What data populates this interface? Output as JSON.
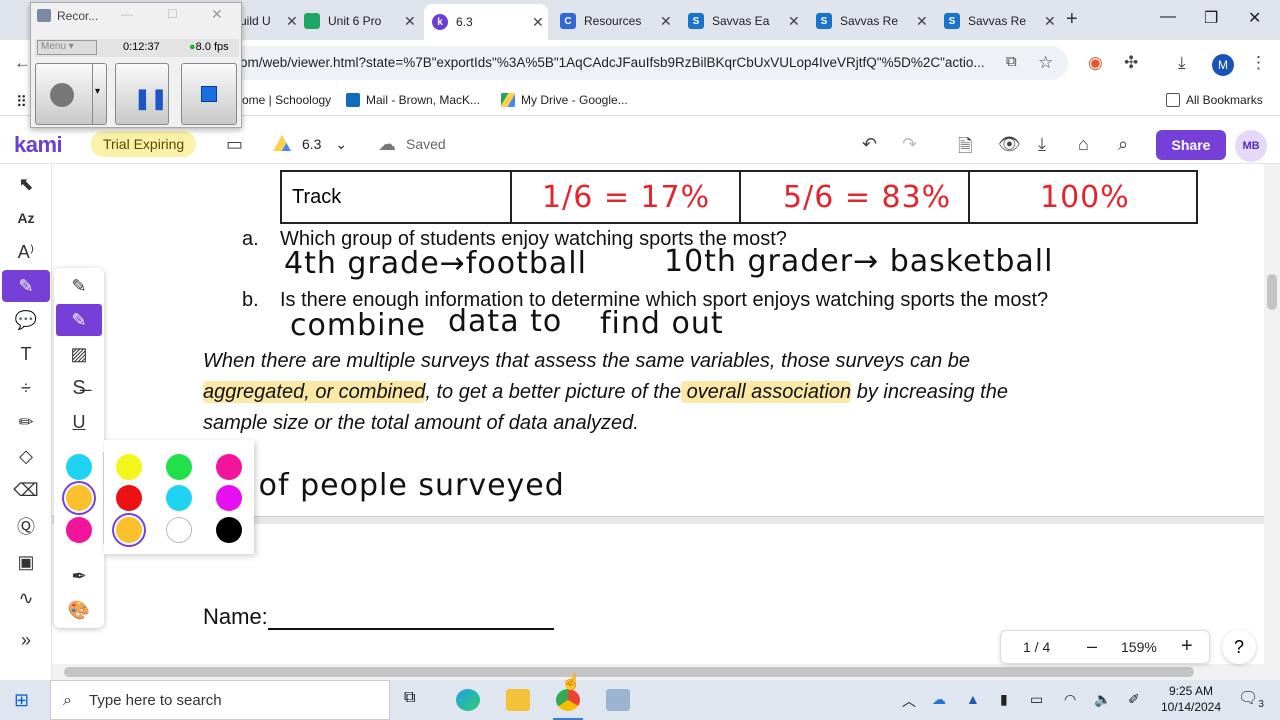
{
  "browser": {
    "tabs": [
      {
        "title": "Build U",
        "icon": "schoology-icon",
        "color": "#3b7dd8"
      },
      {
        "title": "Unit 6 Pro",
        "icon": "google-drive-icon",
        "color": "#1fa463"
      },
      {
        "title": "6.3",
        "icon": "kami-icon",
        "color": "#6b3fd4",
        "active": true
      },
      {
        "title": "Resources",
        "icon": "classroom-icon",
        "color": "#3367d6"
      },
      {
        "title": "Savvas Ea",
        "icon": "savvas-icon",
        "color": "#1a73c8"
      },
      {
        "title": "Savvas Re",
        "icon": "savvas-icon",
        "color": "#1a73c8"
      },
      {
        "title": "Savvas Re",
        "icon": "savvas-icon",
        "color": "#1a73c8"
      }
    ],
    "url": "om/web/viewer.html?state=%7B\"exportIds\"%3A%5B\"1AqCAdcJFauIfsb9RzBilBKqrCbUxVULop4IveVRjtfQ\"%5D%2C\"actio...",
    "profile_initial": "M",
    "bookmarks": [
      {
        "label": "ome | Schoology"
      },
      {
        "label": "Mail - Brown, MacK..."
      },
      {
        "label": "My Drive - Google..."
      }
    ],
    "all_bookmarks": "All Bookmarks"
  },
  "recorder": {
    "title": "Recor...",
    "menu": "Menu",
    "time": "0:12:37",
    "fps": "8.0 fps"
  },
  "kami": {
    "logo": "kami",
    "trial": "Trial Expiring",
    "doc_name": "6.3",
    "saved": "Saved",
    "share": "Share",
    "avatar": "MB"
  },
  "document": {
    "table_row": {
      "label": "Track",
      "c1": "1/6 = 17%",
      "c2": "5/6 = 83%",
      "c3": "100%"
    },
    "q_a_letter": "a.",
    "q_a": "Which group of students enjoy watching sports the most?",
    "ans_a1": "4th grade→football",
    "ans_a2": "10th grader→ basketball",
    "q_b_letter": "b.",
    "q_b": "Is there enough information to determine which sport enjoys watching sports the most?",
    "ans_b1": "combine",
    "ans_b2": "data to",
    "ans_b3": "find out",
    "para1": "When there are multiple surveys that assess the same variables, those surveys can be",
    "para2_hl1": "aggregated, or combined",
    "para2_mid": ", to get a better picture of the",
    "para2_hl2": " overall association",
    "para2_end": " by increasing the",
    "para3": "sample size or the total amount of data analyzed.",
    "hand_note": "# of people surveyed",
    "name_label": "Name:"
  },
  "zoom": {
    "page": "1 / 4",
    "minus": "–",
    "level": "159%",
    "plus": "+"
  },
  "help": "?",
  "colors": {
    "row1": [
      "#1fd3f2",
      "#f3f51b",
      "#22e04a",
      "#f2149a"
    ],
    "row2": [
      "#fbc02d",
      "#ee1111",
      "#1fd3f2",
      "#e60ff0"
    ],
    "row3": [
      "#f2149a",
      "#fbc02d",
      "#ffffff",
      "#000000"
    ]
  },
  "taskbar": {
    "search_placeholder": "Type here to search",
    "time": "9:25 AM",
    "date": "10/14/2024",
    "notif_count": "3"
  }
}
